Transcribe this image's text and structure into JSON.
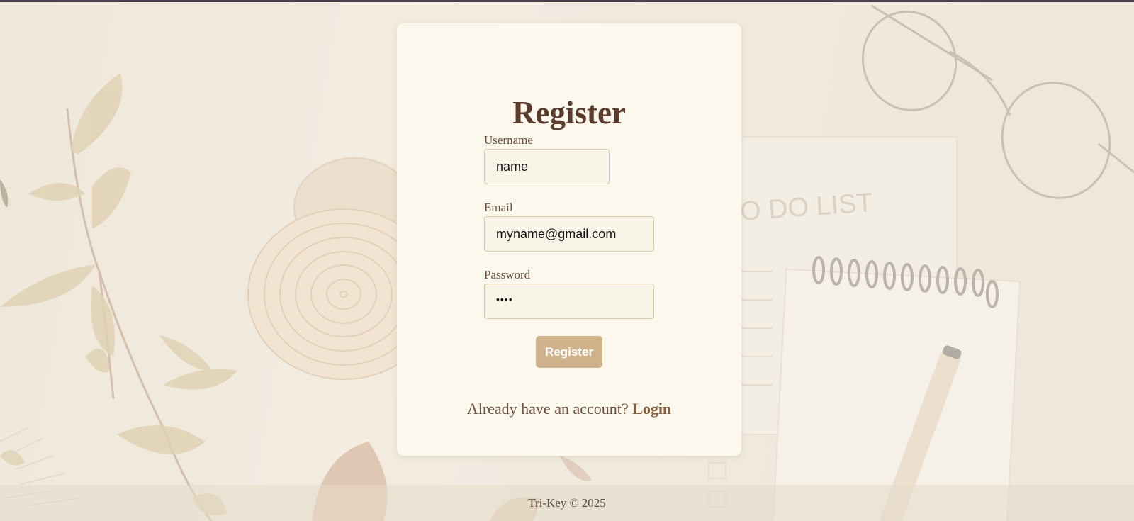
{
  "form": {
    "title": "Register",
    "username": {
      "label": "Username",
      "value": "name"
    },
    "email": {
      "label": "Email",
      "value": "myname@gmail.com"
    },
    "password": {
      "label": "Password",
      "masked_value": "••••"
    },
    "submit_label": "Register"
  },
  "login_prompt": {
    "text": "Already have an account?",
    "link_label": "Login"
  },
  "footer": {
    "text": "Tri-Key © 2025"
  },
  "background_photo": {
    "notepad_heading": "O DO LIST"
  },
  "colors": {
    "card": "#fcf8ee",
    "title": "#5b3c2c",
    "button": "#cfb28a",
    "link": "#8b6040",
    "input_border": "#d8c9a6"
  }
}
